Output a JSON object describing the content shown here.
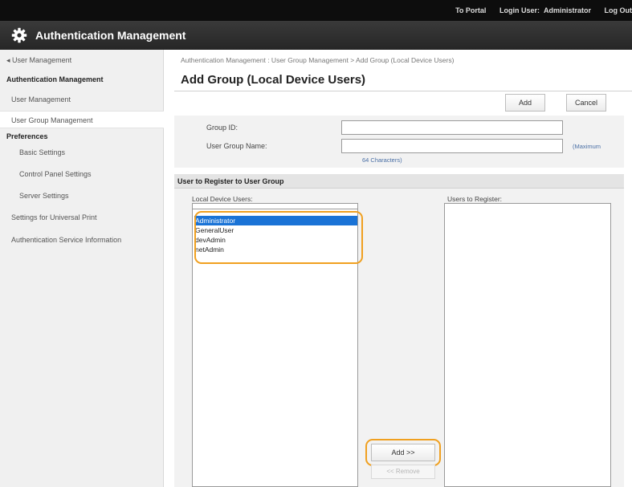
{
  "topbar": {
    "to_portal": "To Portal",
    "login_user_label": "Login User:",
    "login_user_name": "Administrator",
    "logout": "Log Out"
  },
  "header": {
    "title": "Authentication Management",
    "icon": "gear-icon"
  },
  "sidebar": {
    "back_link": "User Management",
    "section_auth": "Authentication Management",
    "user_management": "User Management",
    "user_group_management": "User Group Management",
    "section_preferences": "Preferences",
    "basic_settings": "Basic Settings",
    "control_panel_settings": "Control Panel Settings",
    "server_settings": "Server Settings",
    "settings_universal_print": "Settings for Universal Print",
    "auth_service_info": "Authentication Service Information"
  },
  "main": {
    "breadcrumb": "Authentication Management : User Group Management > Add Group (Local Device Users)",
    "page_title": "Add Group (Local Device Users)",
    "add_button": "Add",
    "cancel_button": "Cancel",
    "form": {
      "group_id_label": "Group ID:",
      "group_id_value": "",
      "user_group_name_label": "User Group Name:",
      "user_group_name_value": "",
      "max_hint_1": "(Maximum",
      "max_hint_2": "64 Characters)"
    },
    "register": {
      "title": "User to Register to User Group",
      "local_users_label": "Local Device Users:",
      "users_to_register_label": "Users to Register:",
      "local_users": [
        "Administrator",
        "GeneralUser",
        "devAdmin",
        "netAdmin"
      ],
      "selected_user": "Administrator",
      "users_to_register": [],
      "add_move_button": "Add >>",
      "remove_button": "<< Remove"
    }
  },
  "colors": {
    "highlight": "#f0a020",
    "selection": "#1a73d6",
    "topbar": "#0d0d0d"
  }
}
